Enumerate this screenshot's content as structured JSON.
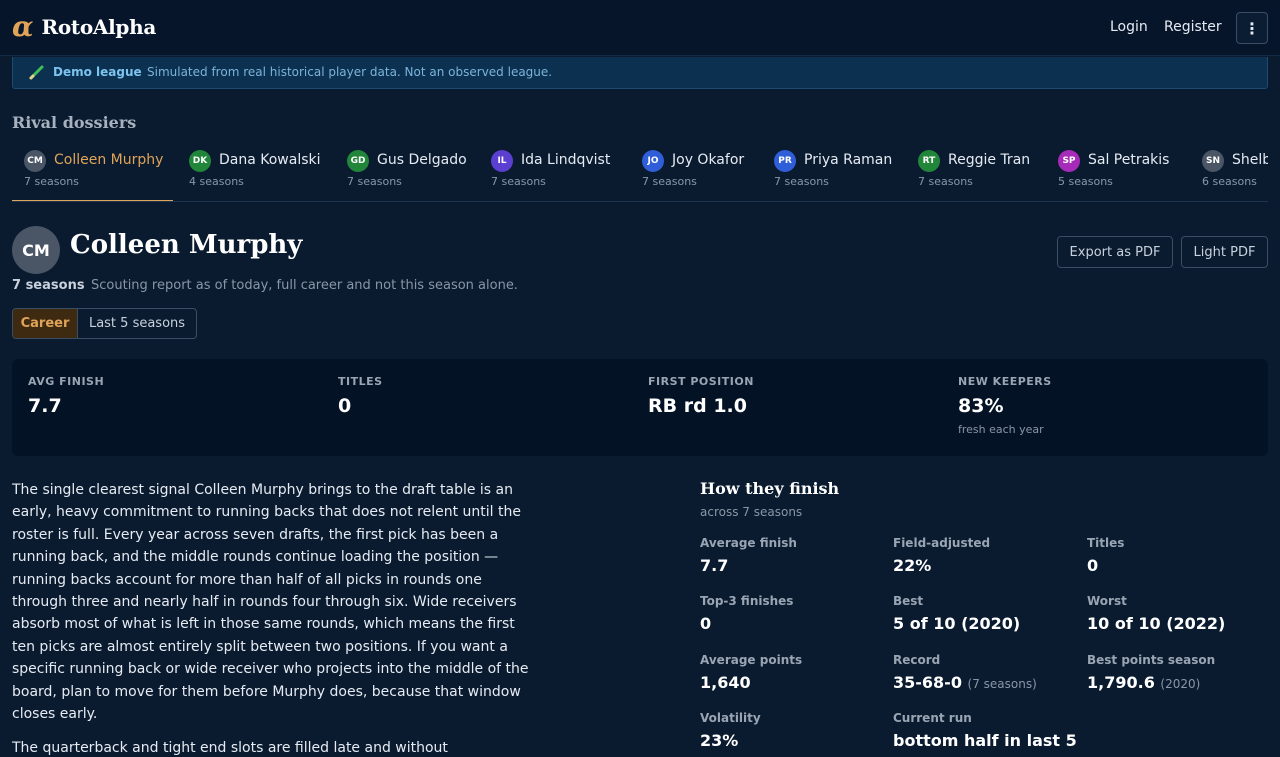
{
  "header": {
    "logo_mark": "α",
    "app_name": "RotoAlpha",
    "login": "Login",
    "register": "Register",
    "menu_icon": "⋮"
  },
  "banner": {
    "title": "Demo league",
    "text": "Simulated from real historical player data. Not an observed league."
  },
  "rivals": {
    "title": "Rival dossiers",
    "items": [
      {
        "initials": "CM",
        "name": "Colleen Murphy",
        "seasons": "7 seasons",
        "color": "#4a5566"
      },
      {
        "initials": "DK",
        "name": "Dana Kowalski",
        "seasons": "4 seasons",
        "color": "#22863a"
      },
      {
        "initials": "GD",
        "name": "Gus Delgado",
        "seasons": "7 seasons",
        "color": "#22863a"
      },
      {
        "initials": "IL",
        "name": "Ida Lindqvist",
        "seasons": "7 seasons",
        "color": "#5b3fd1"
      },
      {
        "initials": "JO",
        "name": "Joy Okafor",
        "seasons": "7 seasons",
        "color": "#2f5ed8"
      },
      {
        "initials": "PR",
        "name": "Priya Raman",
        "seasons": "7 seasons",
        "color": "#2f5ed8"
      },
      {
        "initials": "RT",
        "name": "Reggie Tran",
        "seasons": "7 seasons",
        "color": "#22863a"
      },
      {
        "initials": "SP",
        "name": "Sal Petrakis",
        "seasons": "5 seasons",
        "color": "#a62bb8"
      },
      {
        "initials": "SN",
        "name": "Shelby",
        "seasons": "6 seasons",
        "color": "#4a5566"
      }
    ]
  },
  "profile": {
    "initials": "CM",
    "name": "Colleen Murphy",
    "seasons": "7 seasons",
    "description": "Scouting report as of today, full career and not this season alone.",
    "export_pdf": "Export as PDF",
    "light_pdf": "Light PDF",
    "toggle_career": "Career",
    "toggle_last5": "Last 5 seasons"
  },
  "stats": [
    {
      "label": "AVG FINISH",
      "value": "7.7",
      "sub": ""
    },
    {
      "label": "TITLES",
      "value": "0",
      "sub": ""
    },
    {
      "label": "FIRST POSITION",
      "value": "RB rd 1.0",
      "sub": ""
    },
    {
      "label": "NEW KEEPERS",
      "value": "83%",
      "sub": "fresh each year"
    }
  ],
  "report": {
    "p1": "The single clearest signal Colleen Murphy brings to the draft table is an early, heavy commitment to running backs that does not relent until the roster is full. Every year across seven drafts, the first pick has been a running back, and the middle rounds continue loading the position — running backs account for more than half of all picks in rounds one through three and nearly half in rounds four through six. Wide receivers absorb most of what is left in those same rounds, which means the first ten picks are almost entirely split between two positions. If you want a specific running back or wide receiver who projects into the middle of the board, plan to move for them before Murphy does, because that window closes early.",
    "p2": "The quarterback and tight end slots are filled late and without"
  },
  "finish": {
    "title": "How they finish",
    "subtitle": "across 7 seasons",
    "cells": [
      {
        "label": "Average finish",
        "value": "7.7",
        "note": ""
      },
      {
        "label": "Field-adjusted",
        "value": "22%",
        "note": ""
      },
      {
        "label": "Titles",
        "value": "0",
        "note": ""
      },
      {
        "label": "Top-3 finishes",
        "value": "0",
        "note": ""
      },
      {
        "label": "Best",
        "value": "5 of 10 (2020)",
        "note": ""
      },
      {
        "label": "Worst",
        "value": "10 of 10 (2022)",
        "note": ""
      },
      {
        "label": "Average points",
        "value": "1,640",
        "note": ""
      },
      {
        "label": "Record",
        "value": "35-68-0",
        "note": "(7 seasons)"
      },
      {
        "label": "Best points season",
        "value": "1,790.6",
        "note": "(2020)"
      },
      {
        "label": "Volatility",
        "value": "23%",
        "note": ""
      },
      {
        "label": "Current run",
        "value": "bottom half in last 5",
        "note": ""
      }
    ]
  }
}
